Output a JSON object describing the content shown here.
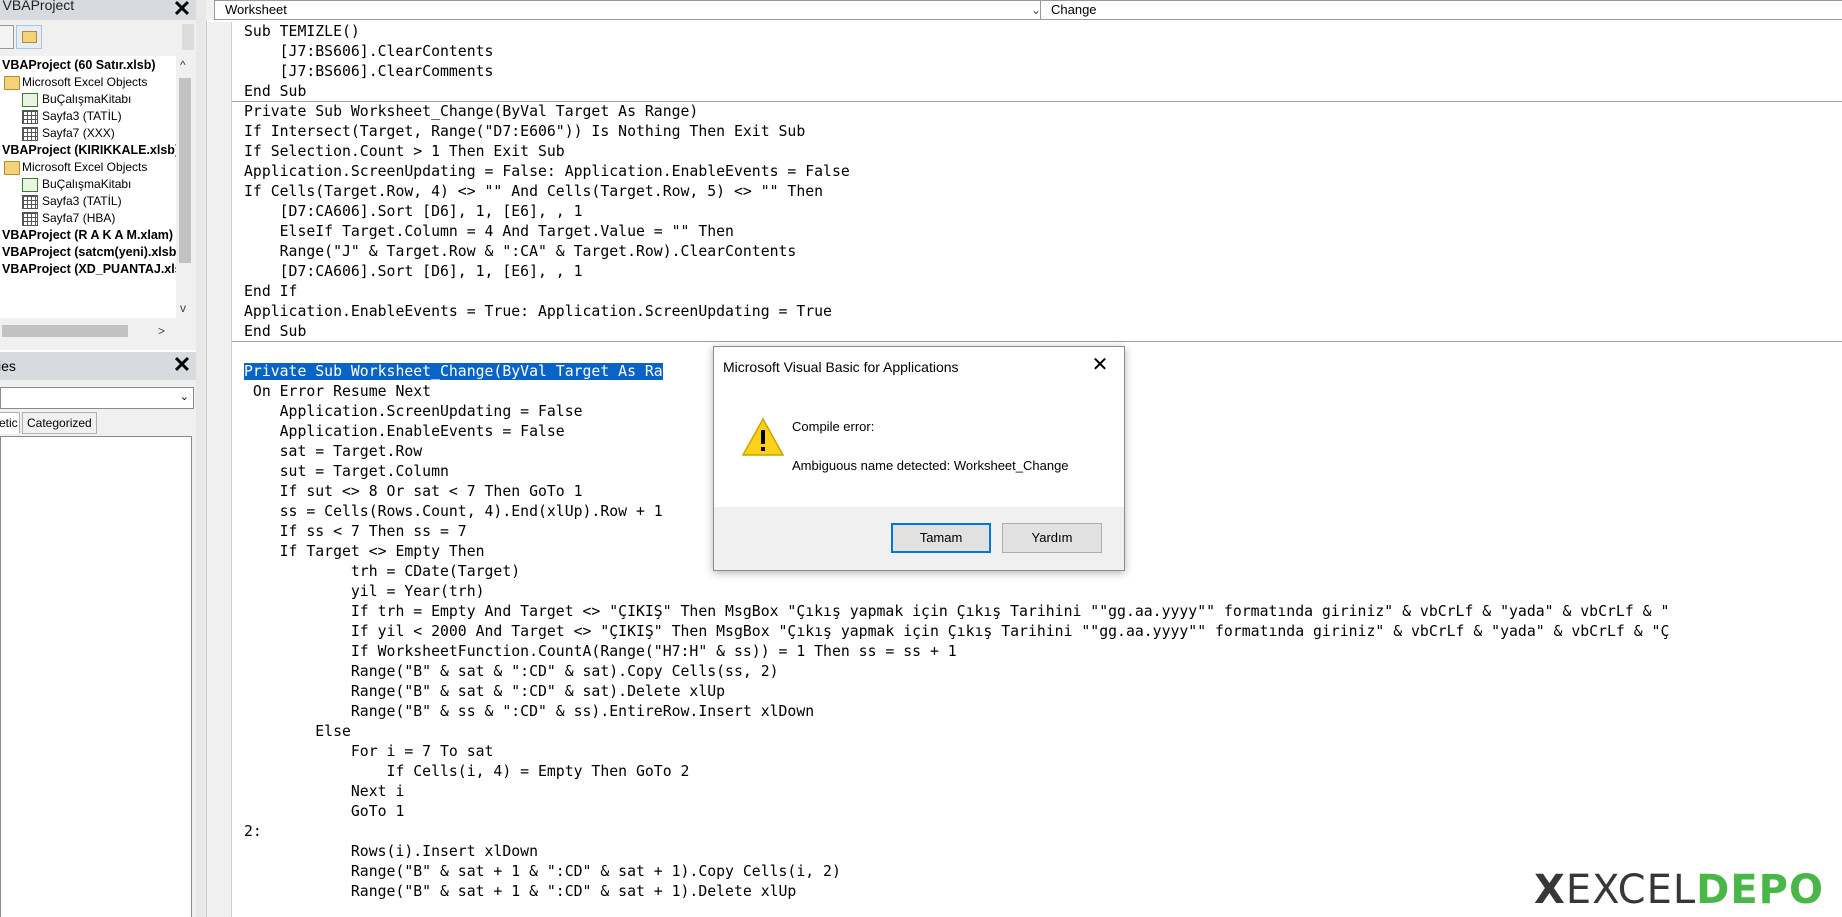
{
  "project_explorer": {
    "title": "- VBAProject",
    "tree": [
      {
        "label": "VBAProject (60 Satır.xlsb)",
        "kind": "project",
        "caret": "^"
      },
      {
        "label": "Microsoft Excel Objects",
        "kind": "folder"
      },
      {
        "label": "BuÇalışmaKitabı",
        "kind": "workbook"
      },
      {
        "label": "Sayfa3 (TATİL)",
        "kind": "sheet"
      },
      {
        "label": "Sayfa7 (XXX)",
        "kind": "sheet"
      },
      {
        "label": "VBAProject (KIRIKKALE.xlsb)",
        "kind": "project"
      },
      {
        "label": "Microsoft Excel Objects",
        "kind": "folder"
      },
      {
        "label": "BuÇalışmaKitabı",
        "kind": "workbook"
      },
      {
        "label": "Sayfa3 (TATİL)",
        "kind": "sheet"
      },
      {
        "label": "Sayfa7 (HBA)",
        "kind": "sheet"
      },
      {
        "label": "VBAProject (R A K A M.xlam)",
        "kind": "project"
      },
      {
        "label": "VBAProject (satcm(yeni).xlsb)",
        "kind": "project"
      },
      {
        "label": "VBAProject (XD_PUANTAJ.xlsm)",
        "kind": "project"
      }
    ]
  },
  "properties": {
    "title": "ies",
    "tabs": [
      "etic",
      "Categorized"
    ]
  },
  "code_header": {
    "object_combo": "Worksheet",
    "procedure_combo": "Change"
  },
  "code_lines": [
    "Sub TEMIZLE()",
    "    [J7:BS606].ClearContents",
    "    [J7:BS606].ClearComments",
    "End Sub",
    "Private Sub Worksheet_Change(ByVal Target As Range)",
    "If Intersect(Target, Range(\"D7:E606\")) Is Nothing Then Exit Sub",
    "If Selection.Count > 1 Then Exit Sub",
    "Application.ScreenUpdating = False: Application.EnableEvents = False",
    "If Cells(Target.Row, 4) <> \"\" And Cells(Target.Row, 5) <> \"\" Then",
    "    [D7:CA606].Sort [D6], 1, [E6], , 1",
    "    ElseIf Target.Column = 4 And Target.Value = \"\" Then",
    "    Range(\"J\" & Target.Row & \":CA\" & Target.Row).ClearContents",
    "    [D7:CA606].Sort [D6], 1, [E6], , 1",
    "End If",
    "Application.EnableEvents = True: Application.ScreenUpdating = True",
    "End Sub",
    "",
    "Private Sub Worksheet_Change(ByVal Target As Ra",
    " On Error Resume Next",
    "    Application.ScreenUpdating = False",
    "    Application.EnableEvents = False",
    "    sat = Target.Row",
    "    sut = Target.Column",
    "    If sut <> 8 Or sat < 7 Then GoTo 1",
    "    ss = Cells(Rows.Count, 4).End(xlUp).Row + 1",
    "    If ss < 7 Then ss = 7",
    "    If Target <> Empty Then",
    "            trh = CDate(Target)",
    "            yil = Year(trh)",
    "            If trh = Empty And Target <> \"ÇIKIŞ\" Then MsgBox \"Çıkış yapmak için Çıkış Tarihini \"\"gg.aa.yyyy\"\" formatında giriniz\" & vbCrLf & \"yada\" & vbCrLf & \"",
    "            If yil < 2000 And Target <> \"ÇIKIŞ\" Then MsgBox \"Çıkış yapmak için Çıkış Tarihini \"\"gg.aa.yyyy\"\" formatında giriniz\" & vbCrLf & \"yada\" & vbCrLf & \"Ç",
    "            If WorksheetFunction.CountA(Range(\"H7:H\" & ss)) = 1 Then ss = ss + 1",
    "            Range(\"B\" & sat & \":CD\" & sat).Copy Cells(ss, 2)",
    "            Range(\"B\" & sat & \":CD\" & sat).Delete xlUp",
    "            Range(\"B\" & ss & \":CD\" & ss).EntireRow.Insert xlDown",
    "        Else",
    "            For i = 7 To sat",
    "                If Cells(i, 4) = Empty Then GoTo 2",
    "            Next i",
    "            GoTo 1",
    "2:",
    "            Rows(i).Insert xlDown",
    "            Range(\"B\" & sat + 1 & \":CD\" & sat + 1).Copy Cells(i, 2)",
    "            Range(\"B\" & sat + 1 & \":CD\" & sat + 1).Delete xlUp"
  ],
  "dialog": {
    "title": "Microsoft Visual Basic for Applications",
    "line1": "Compile error:",
    "line2": "Ambiguous name detected: Worksheet_Change",
    "ok_label": "Tamam",
    "help_label": "Yardım"
  },
  "watermark": {
    "prefix": "EXCEL",
    "suffix": "DEPO"
  }
}
